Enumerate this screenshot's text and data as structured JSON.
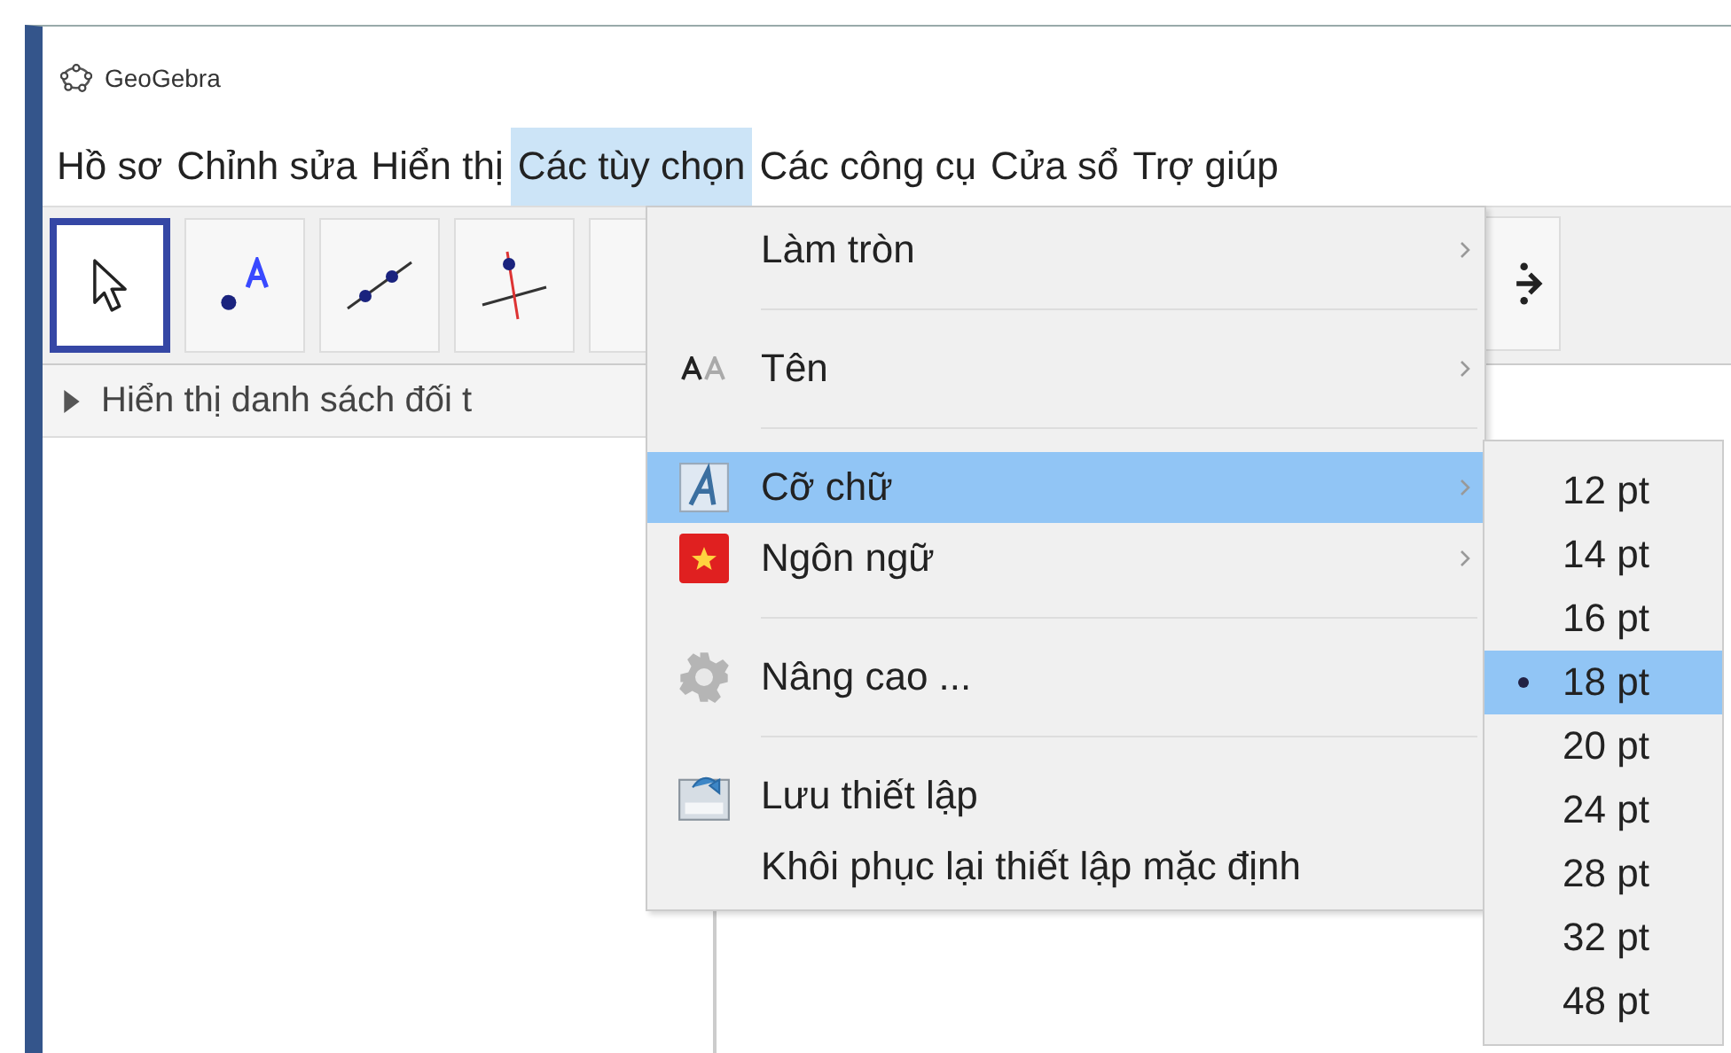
{
  "window": {
    "title": "GeoGebra"
  },
  "menu_bar": [
    {
      "label": "Hồ sơ",
      "selected": false
    },
    {
      "label": "Chỉnh sửa",
      "selected": false
    },
    {
      "label": "Hiển thị",
      "selected": false
    },
    {
      "label": "Các tùy chọn",
      "selected": true
    },
    {
      "label": "Các công cụ",
      "selected": false
    },
    {
      "label": "Cửa sổ",
      "selected": false
    },
    {
      "label": "Trợ giúp",
      "selected": false
    }
  ],
  "algebra_header": {
    "label": "Hiển thị danh sách đối t"
  },
  "dropdown_menu": [
    {
      "kind": "plain",
      "label": "Làm tròn",
      "submenu": true,
      "selected": false
    },
    {
      "kind": "separator"
    },
    {
      "kind": "labels",
      "label": "Tên",
      "submenu": true,
      "selected": false
    },
    {
      "kind": "separator"
    },
    {
      "kind": "font",
      "label": "Cỡ chữ",
      "submenu": true,
      "selected": true
    },
    {
      "kind": "language",
      "label": "Ngôn ngữ",
      "submenu": true,
      "selected": false
    },
    {
      "kind": "separator"
    },
    {
      "kind": "advanced",
      "label": "Nâng cao ...",
      "submenu": false,
      "selected": false
    },
    {
      "kind": "separator"
    },
    {
      "kind": "save",
      "label": "Lưu thiết lập",
      "submenu": false,
      "selected": false
    },
    {
      "kind": "plain",
      "label": "Khôi phục lại thiết lập mặc định",
      "submenu": false,
      "selected": false
    }
  ],
  "font_size_submenu": [
    {
      "label": "12 pt",
      "selected": false
    },
    {
      "label": "14 pt",
      "selected": false
    },
    {
      "label": "16 pt",
      "selected": false
    },
    {
      "label": "18 pt",
      "selected": true
    },
    {
      "label": "20 pt",
      "selected": false
    },
    {
      "label": "24 pt",
      "selected": false
    },
    {
      "label": "28 pt",
      "selected": false
    },
    {
      "label": "32 pt",
      "selected": false
    },
    {
      "label": "48 pt",
      "selected": false
    }
  ]
}
